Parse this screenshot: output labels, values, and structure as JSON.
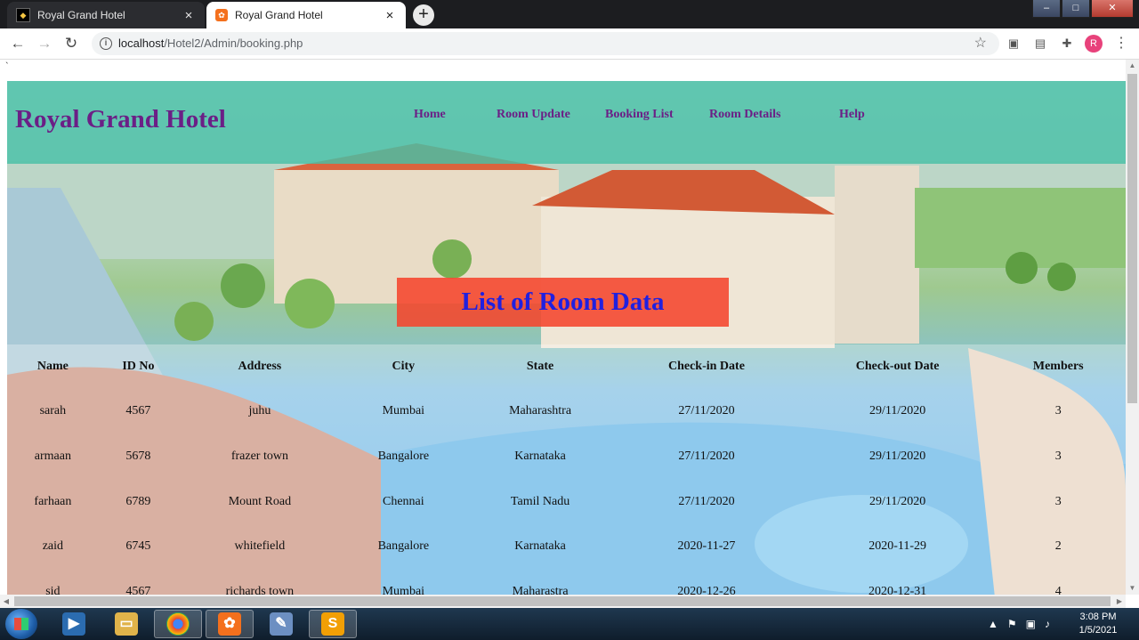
{
  "browser": {
    "tabs": [
      {
        "title": "Royal Grand Hotel",
        "active": false
      },
      {
        "title": "Royal Grand Hotel",
        "active": true
      }
    ],
    "new_tab": "+",
    "window_controls": {
      "minimize": "–",
      "maximize": "□",
      "close": "✕"
    },
    "url_host": "localhost",
    "url_path": "/Hotel2/Admin/booking.php",
    "profile_initial": "R"
  },
  "page": {
    "stray_char": "`",
    "brand": "Royal Grand Hotel",
    "nav": [
      "Home",
      "Room Update",
      "Booking List",
      "Room Details",
      "Help"
    ],
    "heading": "List of Room Data",
    "table": {
      "headers": [
        "Name",
        "ID No",
        "Address",
        "City",
        "State",
        "Check-in Date",
        "Check-out Date",
        "Members"
      ],
      "rows": [
        [
          "sarah",
          "4567",
          "juhu",
          "Mumbai",
          "Maharashtra",
          "27/11/2020",
          "29/11/2020",
          "3"
        ],
        [
          "armaan",
          "5678",
          "frazer town",
          "Bangalore",
          "Karnataka",
          "27/11/2020",
          "29/11/2020",
          "3"
        ],
        [
          "farhaan",
          "6789",
          "Mount Road",
          "Chennai",
          "Tamil Nadu",
          "27/11/2020",
          "29/11/2020",
          "3"
        ],
        [
          "zaid",
          "6745",
          "whitefield",
          "Bangalore",
          "Karnataka",
          "2020-11-27",
          "2020-11-29",
          "2"
        ],
        [
          "sid",
          "4567",
          "richards town",
          "Mumbai",
          "Maharastra",
          "2020-12-26",
          "2020-12-31",
          "4"
        ]
      ]
    }
  },
  "taskbar": {
    "apps": [
      "media-player",
      "file-explorer",
      "chrome",
      "xampp",
      "paint",
      "sublime-text"
    ],
    "active_app": "chrome",
    "clock_time": "3:08 PM",
    "clock_date": "1/5/2021"
  },
  "colors": {
    "header_bg": "#48bfa6",
    "brand_text": "#6b1f86",
    "heading_bg": "#f5462d",
    "heading_text": "#2020e0"
  }
}
